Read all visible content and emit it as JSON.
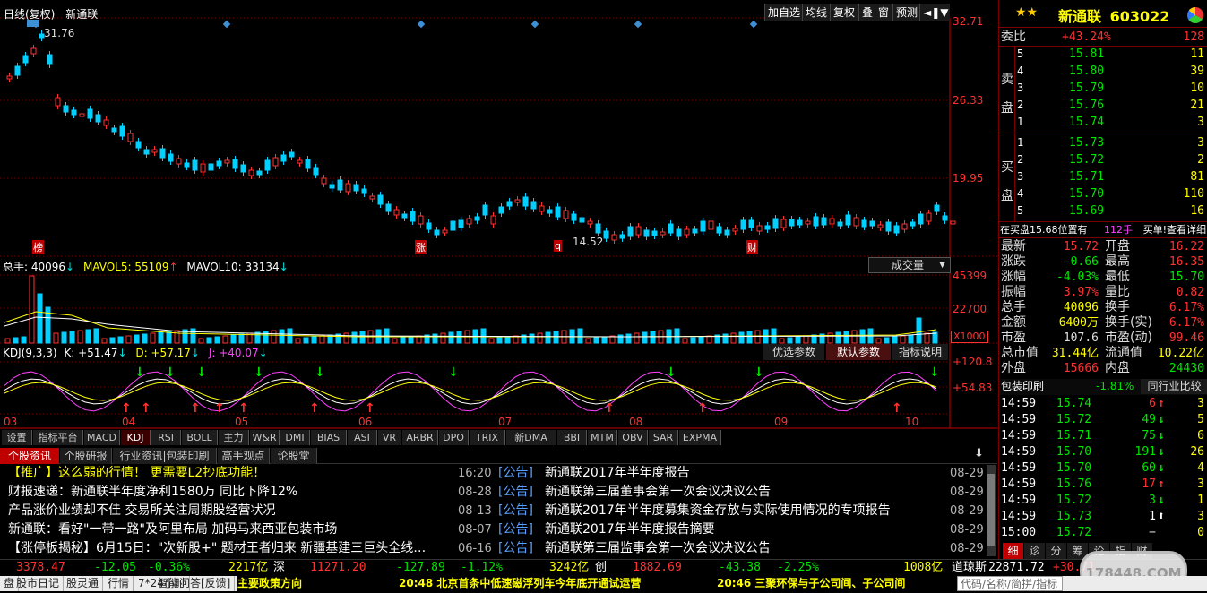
{
  "header": {
    "period": "日线(复权)",
    "name": "新通联"
  },
  "toolbar": [
    "加自选",
    "均线",
    "复权",
    "叠",
    "窗",
    "预测"
  ],
  "price_axis": [
    "32.71",
    "26.33",
    "19.95"
  ],
  "price_labels": {
    "high": "31.76",
    "low": "14.52"
  },
  "event_markers": [
    "榜",
    "涨",
    "q",
    "财"
  ],
  "volume": {
    "total_label": "总手: 40096",
    "mavol5": "MAVOL5: 55109",
    "mavol10": "MAVOL10: 33134",
    "dropdown": "成交量",
    "axis": [
      "45399",
      "22700",
      "X1000"
    ]
  },
  "kdj": {
    "label": "KDJ(9,3,3)",
    "k": "K: +51.47",
    "d": "D: +57.17",
    "j": "J: +40.07",
    "buttons": [
      "优选参数",
      "默认参数",
      "指标说明"
    ],
    "axis": [
      "+120.8",
      "+54.83"
    ]
  },
  "months": [
    "03",
    "04",
    "05",
    "06",
    "07",
    "08",
    "09",
    "10"
  ],
  "indicator_tabs": [
    "设置",
    "指标平台",
    "MACD",
    "KDJ",
    "RSI",
    "BOLL",
    "主力",
    "W&R",
    "DMI",
    "BIAS",
    "ASI",
    "VR",
    "ARBR",
    "DPO",
    "TRIX",
    "新DMA",
    "BBI",
    "MTM",
    "OBV",
    "SAR",
    "EXPMA"
  ],
  "news_tabs": [
    "个股资讯",
    "个股研报",
    "行业资讯|包装印刷",
    "高手观点",
    "论股堂"
  ],
  "news_left": [
    "【推广】这么弱的行情！ 更需要L2抄底功能！",
    "财报速递：新通联半年度净利1580万 同比下降12%",
    "产品涨价业绩却不佳 交易所关注周期股经营状况",
    "新通联：看好\"一带一路\"及阿里布局 加码马来西亚包装市场",
    "【涨停板揭秘】6月15日：\"次新股+\" 题材王者归来 新疆基建三巨头全线…"
  ],
  "news_left_dates": [
    "16:20",
    "08-28",
    "08-13",
    "08-07",
    "06-16"
  ],
  "news_right": [
    {
      "tag": "[公告]",
      "title": "新通联2017年半年度报告",
      "date": "08-29"
    },
    {
      "tag": "[公告]",
      "title": "新通联第三届董事会第一次会议决议公告",
      "date": "08-29"
    },
    {
      "tag": "[公告]",
      "title": "新通联2017年半年度募集资金存放与实际使用情况的专项报告",
      "date": "08-29"
    },
    {
      "tag": "[公告]",
      "title": "新通联2017年半年度报告摘要",
      "date": "08-29"
    },
    {
      "tag": "[公告]",
      "title": "新通联第三届监事会第一次会议决议公告",
      "date": "08-29"
    }
  ],
  "quote": {
    "name": "新通联",
    "code": "603022",
    "weibi_label": "委比",
    "weibi": "+43.24%",
    "weibi_val": "128",
    "sell": [
      {
        "n": "5",
        "p": "15.81",
        "v": "11"
      },
      {
        "n": "4",
        "p": "15.80",
        "v": "39"
      },
      {
        "n": "3",
        "p": "15.79",
        "v": "10"
      },
      {
        "n": "2",
        "p": "15.76",
        "v": "21"
      },
      {
        "n": "1",
        "p": "15.74",
        "v": "3"
      }
    ],
    "buy": [
      {
        "n": "1",
        "p": "15.73",
        "v": "3"
      },
      {
        "n": "2",
        "p": "15.72",
        "v": "2"
      },
      {
        "n": "3",
        "p": "15.71",
        "v": "81"
      },
      {
        "n": "4",
        "p": "15.70",
        "v": "110"
      },
      {
        "n": "5",
        "p": "15.69",
        "v": "16"
      }
    ],
    "sell_label": [
      "卖",
      "盘"
    ],
    "buy_label": [
      "买",
      "盘"
    ],
    "inbuy": "在买盘15.68位置有",
    "inbuy_vol": "112手",
    "inbuy_link": "买单!查看详细",
    "stats": [
      [
        "最新",
        "15.72",
        "开盘",
        "16.22"
      ],
      [
        "涨跌",
        "-0.66",
        "最高",
        "16.35"
      ],
      [
        "涨幅",
        "-4.03%",
        "最低",
        "15.70"
      ],
      [
        "振幅",
        "3.97%",
        "量比",
        "0.82"
      ],
      [
        "总手",
        "40096",
        "换手",
        "6.17%"
      ],
      [
        "金额",
        "6400万",
        "换手(实)",
        "6.17%"
      ],
      [
        "市盈",
        "107.6",
        "市盈(动)",
        "99.46"
      ],
      [
        "总市值",
        "31.44亿",
        "流通值",
        "10.22亿"
      ],
      [
        "外盘",
        "15666",
        "内盘",
        "24430"
      ]
    ],
    "industry": "包装印刷",
    "industry_chg": "-1.81%",
    "industry_btn": "同行业比较",
    "ticks": [
      [
        "14:59",
        "15.74",
        "6",
        "3"
      ],
      [
        "14:59",
        "15.72",
        "49",
        "5"
      ],
      [
        "14:59",
        "15.71",
        "75",
        "6"
      ],
      [
        "14:59",
        "15.70",
        "191",
        "26"
      ],
      [
        "14:59",
        "15.70",
        "60",
        "4"
      ],
      [
        "14:59",
        "15.76",
        "17",
        "3"
      ],
      [
        "14:59",
        "15.72",
        "3",
        "1"
      ],
      [
        "14:59",
        "15.73",
        "1",
        "3"
      ],
      [
        "15:00",
        "15.72",
        "−",
        "0"
      ]
    ],
    "right_tabs": [
      "细",
      "诊",
      "分",
      "筹",
      "论",
      "指",
      "财"
    ]
  },
  "ticker": [
    {
      "v": "3378.47",
      "c": "-12.05",
      "p": "-0.36%",
      "a": "2217亿",
      "n": "深"
    },
    {
      "v": "11271.20",
      "c": "-127.89",
      "p": "-1.12%",
      "a": "3242亿",
      "n": "创"
    },
    {
      "v": "1882.69",
      "c": "-43.38",
      "p": "-2.25%",
      "a": "1008亿",
      "n": "道琼斯"
    },
    {
      "v": "22871.72",
      "c": "+30.71"
    }
  ],
  "status": [
    "盘",
    "股市日记",
    "股灵通",
    "行情",
    "7*24小时",
    "智能问答[反馈]",
    "主要政策方向",
    "20:48 北京首条中低速磁浮列车今年底开通试运营",
    "20:46 三聚环保与子公司间、子公司间",
    "代码/名称/简拼/指标"
  ],
  "watermark": "178448.COM"
}
